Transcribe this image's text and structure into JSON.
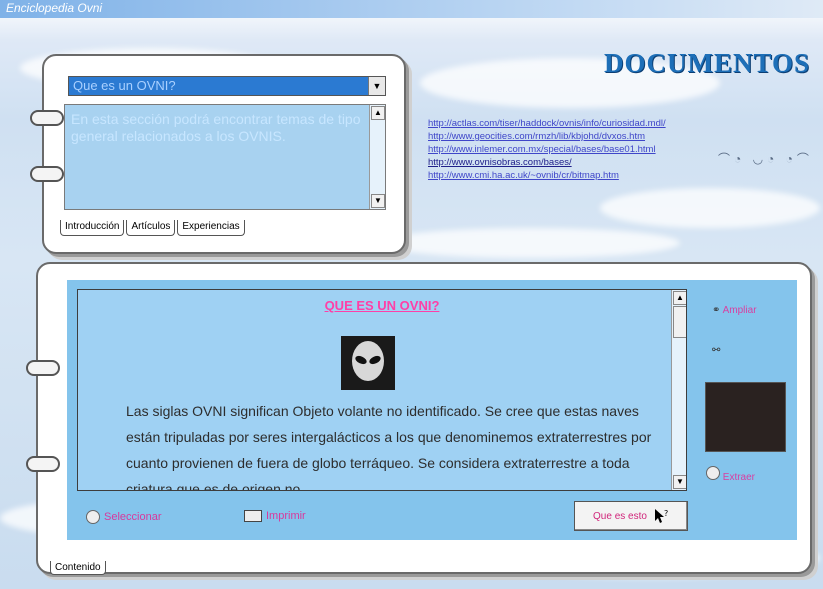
{
  "window": {
    "title": "Enciclopedia Ovni"
  },
  "header": {
    "title": "DOCUMENTOS"
  },
  "top_panel": {
    "selector": {
      "value": "Que es un OVNI?"
    },
    "intro_text": "En esta sección podrá encontrar temas de tipo general relacionados a los OVNIS.",
    "tabs": [
      "Introducción",
      "Artículos",
      "Experiencias"
    ]
  },
  "links": [
    "http://actlas.com/tiser/haddock/ovnis/info/curiosidad.mdl/",
    "http://www.geocities.com/rmzh/lib/kbjohd/dvxos.htm",
    "http://www.inlemer.com.mx/special/bases/base01.html",
    "http://www.ovnisobras.com/bases/",
    "http://www.cmi.ha.ac.uk/~ovnib/cr/bitmap.htm"
  ],
  "content": {
    "heading": "QUE ES UN OVNI?",
    "body": "Las siglas OVNI significan Objeto volante no identificado. Se cree que estas naves están tripuladas por seres intergalácticos a los que denominemos extraterrestres por cuanto provienen de fuera de globo terráqueo. Se considera extraterrestre a toda criatura que es de origen no",
    "side_labels": [
      "Ampliar",
      "",
      "Extraer"
    ],
    "footer": {
      "explore_label": "Seleccionar",
      "print_label": "Imprimir",
      "what_label": "Que es esto"
    },
    "tab": "Contenido"
  }
}
